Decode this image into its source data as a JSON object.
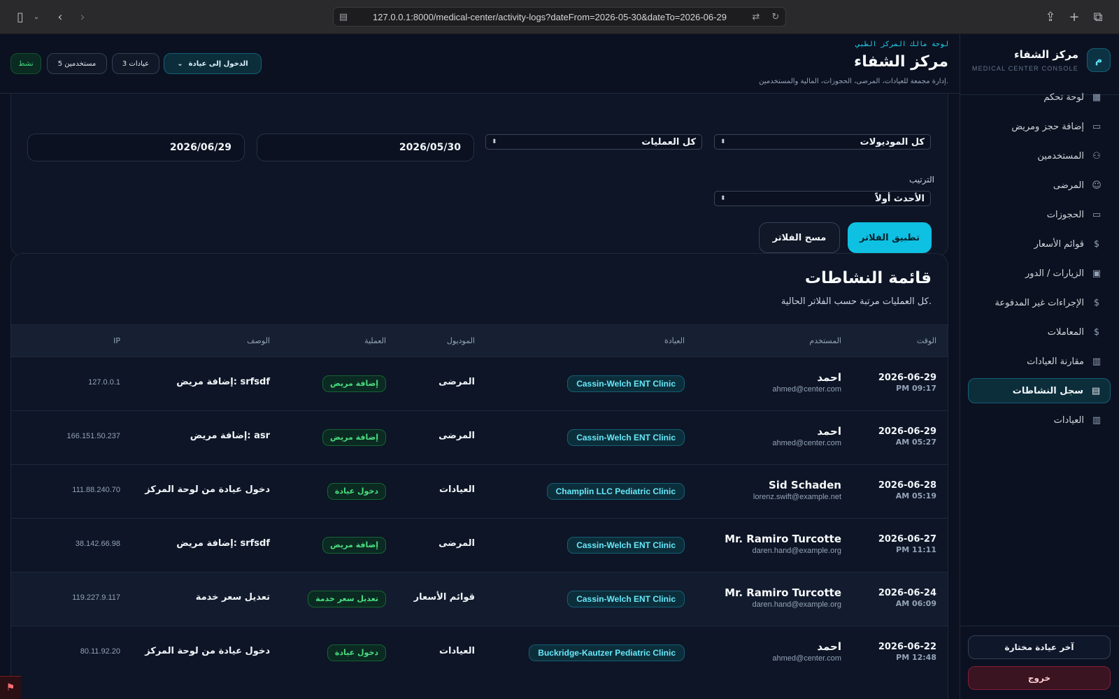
{
  "browser": {
    "url": "127.0.0.1:8000/medical-center/activity-logs?dateFrom=2026-05-30&dateTo=2026-06-29"
  },
  "sidebar": {
    "logo_letter": "م",
    "brand_name": "مركز الشفاء",
    "brand_sub": "MEDICAL CENTER CONSOLE",
    "items": [
      {
        "label": "لوحة تحكم",
        "icon": "dashboard-icon"
      },
      {
        "label": "إضافة حجز ومريض",
        "icon": "calendar-icon"
      },
      {
        "label": "المستخدمين",
        "icon": "users-icon"
      },
      {
        "label": "المرضى",
        "icon": "patients-icon"
      },
      {
        "label": "الحجوزات",
        "icon": "calendar-icon"
      },
      {
        "label": "قوائم الأسعار",
        "icon": "dollar-icon"
      },
      {
        "label": "الزيارات / الدور",
        "icon": "queue-icon"
      },
      {
        "label": "الإجراءات غير المدفوعة",
        "icon": "dollar-icon"
      },
      {
        "label": "المعاملات",
        "icon": "dollar-icon"
      },
      {
        "label": "مقارنة العيادات",
        "icon": "chart-icon"
      },
      {
        "label": "سجل النشاطات",
        "icon": "document-icon"
      },
      {
        "label": "العيادات",
        "icon": "building-icon"
      }
    ],
    "active_index": 10,
    "last_clinic_label": "آخر عيادة مختارة",
    "logout_label": "خروج"
  },
  "header": {
    "kicker": "لوحة مالك المركز الطبي",
    "title": "مركز الشفاء",
    "description": "إدارة مجمعة للعيادات، المرضى، الحجوزات، المالية والمستخدمين.",
    "status": "نشط",
    "users_count": "مستخدمين 5",
    "clinics_count": "عيادات 3",
    "enter_clinic": "الدخول إلى عيادة"
  },
  "filters": {
    "module_value": "كل الموديولات",
    "operation_value": "كل العمليات",
    "date_from": "2026/05/30",
    "date_to": "2026/06/29",
    "sort_label": "الترتيب",
    "sort_value": "الأحدث أولاً",
    "apply_label": "تطبيق الفلاتر",
    "clear_label": "مسح الفلاتر"
  },
  "activity": {
    "title": "قائمة النشاطات",
    "subtitle": "كل العمليات مرتبة حسب الفلاتر الحالية.",
    "columns": {
      "time": "الوقت",
      "user": "المستخدم",
      "clinic": "العيادة",
      "module": "الموديول",
      "operation": "العملية",
      "description": "الوصف",
      "ip": "IP"
    },
    "rows": [
      {
        "date": "2026-06-29",
        "time": "PM 09:17",
        "user": "احمد",
        "email": "ahmed@center.com",
        "clinic": "Cassin-Welch ENT Clinic",
        "module": "المرضى",
        "operation": "إضافة مريض",
        "description": "إضافة مريض: srfsdf",
        "ip": "127.0.0.1"
      },
      {
        "date": "2026-06-29",
        "time": "AM 05:27",
        "user": "احمد",
        "email": "ahmed@center.com",
        "clinic": "Cassin-Welch ENT Clinic",
        "module": "المرضى",
        "operation": "إضافة مريض",
        "description": "إضافة مريض: asr",
        "ip": "166.151.50.237"
      },
      {
        "date": "2026-06-28",
        "time": "AM 05:19",
        "user": "Sid Schaden",
        "email": "lorenz.swift@example.net",
        "clinic": "Champlin LLC Pediatric Clinic",
        "module": "العيادات",
        "operation": "دخول عيادة",
        "description": "دخول عيادة من لوحة المركز",
        "ip": "111.88.240.70"
      },
      {
        "date": "2026-06-27",
        "time": "PM 11:11",
        "user": "Mr. Ramiro Turcotte",
        "email": "daren.hand@example.org",
        "clinic": "Cassin-Welch ENT Clinic",
        "module": "المرضى",
        "operation": "إضافة مريض",
        "description": "إضافة مريض: srfsdf",
        "ip": "38.142.66.98"
      },
      {
        "date": "2026-06-24",
        "time": "AM 06:09",
        "user": "Mr. Ramiro Turcotte",
        "email": "daren.hand@example.org",
        "clinic": "Cassin-Welch ENT Clinic",
        "module": "قوائم الأسعار",
        "operation": "تعديل سعر خدمة",
        "description": "تعديل سعر خدمة",
        "ip": "119.227.9.117"
      },
      {
        "date": "2026-06-22",
        "time": "PM 12:48",
        "user": "احمد",
        "email": "ahmed@center.com",
        "clinic": "Buckridge-Kautzer Pediatric Clinic",
        "module": "العيادات",
        "operation": "دخول عيادة",
        "description": "دخول عيادة من لوحة المركز",
        "ip": "80.11.92.20"
      }
    ]
  }
}
